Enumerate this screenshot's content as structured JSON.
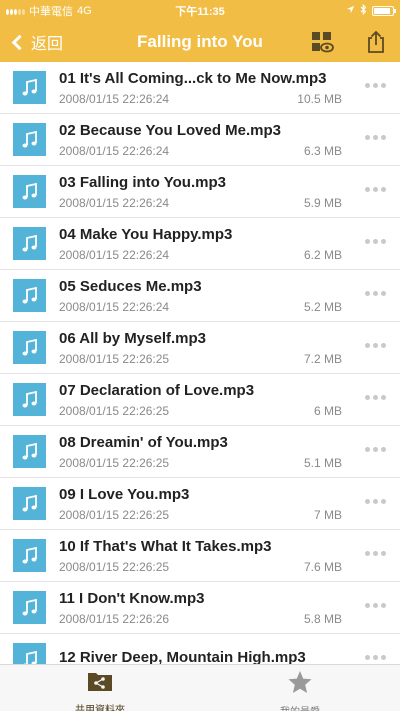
{
  "status_bar": {
    "carrier": "中華電信",
    "network": "4G",
    "time": "下午11:35"
  },
  "nav": {
    "back_label": "返回",
    "title": "Falling into You",
    "brand_color": "#f2bd44"
  },
  "files": [
    {
      "name": "01 It's All Coming...ck to Me Now.mp3",
      "date": "2008/01/15 22:26:24",
      "size": "10.5 MB"
    },
    {
      "name": "02 Because You Loved Me.mp3",
      "date": "2008/01/15 22:26:24",
      "size": "6.3 MB"
    },
    {
      "name": "03 Falling into You.mp3",
      "date": "2008/01/15 22:26:24",
      "size": "5.9 MB"
    },
    {
      "name": "04 Make You Happy.mp3",
      "date": "2008/01/15 22:26:24",
      "size": "6.2 MB"
    },
    {
      "name": "05 Seduces Me.mp3",
      "date": "2008/01/15 22:26:24",
      "size": "5.2 MB"
    },
    {
      "name": "06 All by Myself.mp3",
      "date": "2008/01/15 22:26:25",
      "size": "7.2 MB"
    },
    {
      "name": "07 Declaration of Love.mp3",
      "date": "2008/01/15 22:26:25",
      "size": "6 MB"
    },
    {
      "name": "08 Dreamin' of You.mp3",
      "date": "2008/01/15 22:26:25",
      "size": "5.1 MB"
    },
    {
      "name": "09 I Love You.mp3",
      "date": "2008/01/15 22:26:25",
      "size": "7 MB"
    },
    {
      "name": "10 If That's What It Takes.mp3",
      "date": "2008/01/15 22:26:25",
      "size": "7.6 MB"
    },
    {
      "name": "11 I Don't Know.mp3",
      "date": "2008/01/15 22:26:26",
      "size": "5.8 MB"
    },
    {
      "name": "12 River Deep, Mountain High.mp3",
      "date": "",
      "size": ""
    }
  ],
  "file_icon": "music-note-icon",
  "file_icon_color": "#53b3d8",
  "tabs": [
    {
      "label": "共用資料夾",
      "icon": "shared-folder-icon",
      "active": true
    },
    {
      "label": "我的最愛",
      "icon": "star-icon",
      "active": false
    }
  ]
}
